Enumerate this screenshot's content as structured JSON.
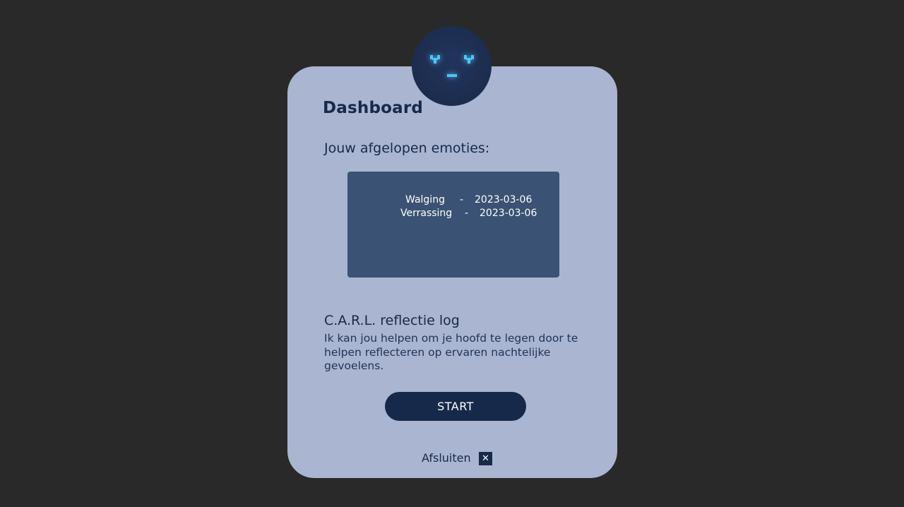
{
  "dashboard": {
    "title": "Dashboard",
    "subtitle": "Jouw afgelopen emoties:",
    "emotions": [
      {
        "emotion": "Walging",
        "separator": "-",
        "date": "2023-03-06"
      },
      {
        "emotion": "Verrassing",
        "separator": "-",
        "date": "2023-03-06"
      }
    ],
    "log_title": "C.A.R.L. reflectie log",
    "log_description": "Ik kan jou helpen om je hoofd te legen door te helpen reflecteren op ervaren nachtelijke gevoelens.",
    "start_label": "START",
    "close_label": "Afsluiten",
    "close_icon_glyph": "✕"
  },
  "colors": {
    "background": "#292929",
    "card": "#a9b5d1",
    "primary": "#17294a",
    "emotions_box": "#3a5273",
    "face_accent": "#4fc3f7"
  },
  "icons": {
    "avatar": "robot-face-icon",
    "close": "close-icon"
  }
}
